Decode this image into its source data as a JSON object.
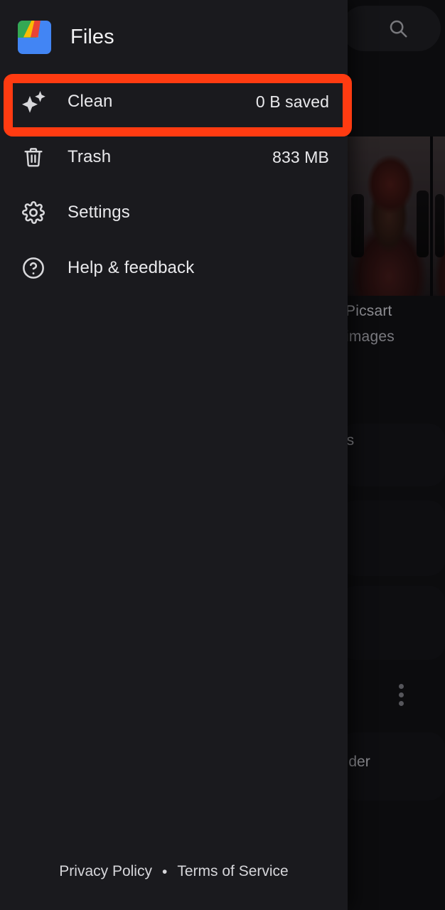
{
  "app": {
    "title": "Files",
    "logo_icon": "files-app-logo",
    "drawer_bg": "#1a1a1e",
    "screen_bg": "#0c0c0e"
  },
  "annotation": {
    "target": "Clean",
    "color": "#ff3b11",
    "shape": "rectangle-outline"
  },
  "drawer": {
    "items": [
      {
        "id": "clean",
        "icon": "sparkle-icon",
        "label": "Clean",
        "value": "0 B saved"
      },
      {
        "id": "trash",
        "icon": "trash-icon",
        "label": "Trash",
        "value": "833 MB"
      },
      {
        "id": "settings",
        "icon": "gear-icon",
        "label": "Settings",
        "value": ""
      },
      {
        "id": "help-feedback",
        "icon": "help-circle-icon",
        "label": "Help & feedback",
        "value": ""
      }
    ],
    "footer": {
      "privacy": "Privacy Policy",
      "separator": "•",
      "terms": "Terms of Service"
    }
  },
  "background": {
    "search_icon": "search-icon",
    "overflow_icon": "kebab-menu-icon",
    "labels": {
      "picsart": "Picsart",
      "images": "images",
      "card_title": "es",
      "card_sub": "s",
      "folder": "older"
    }
  }
}
